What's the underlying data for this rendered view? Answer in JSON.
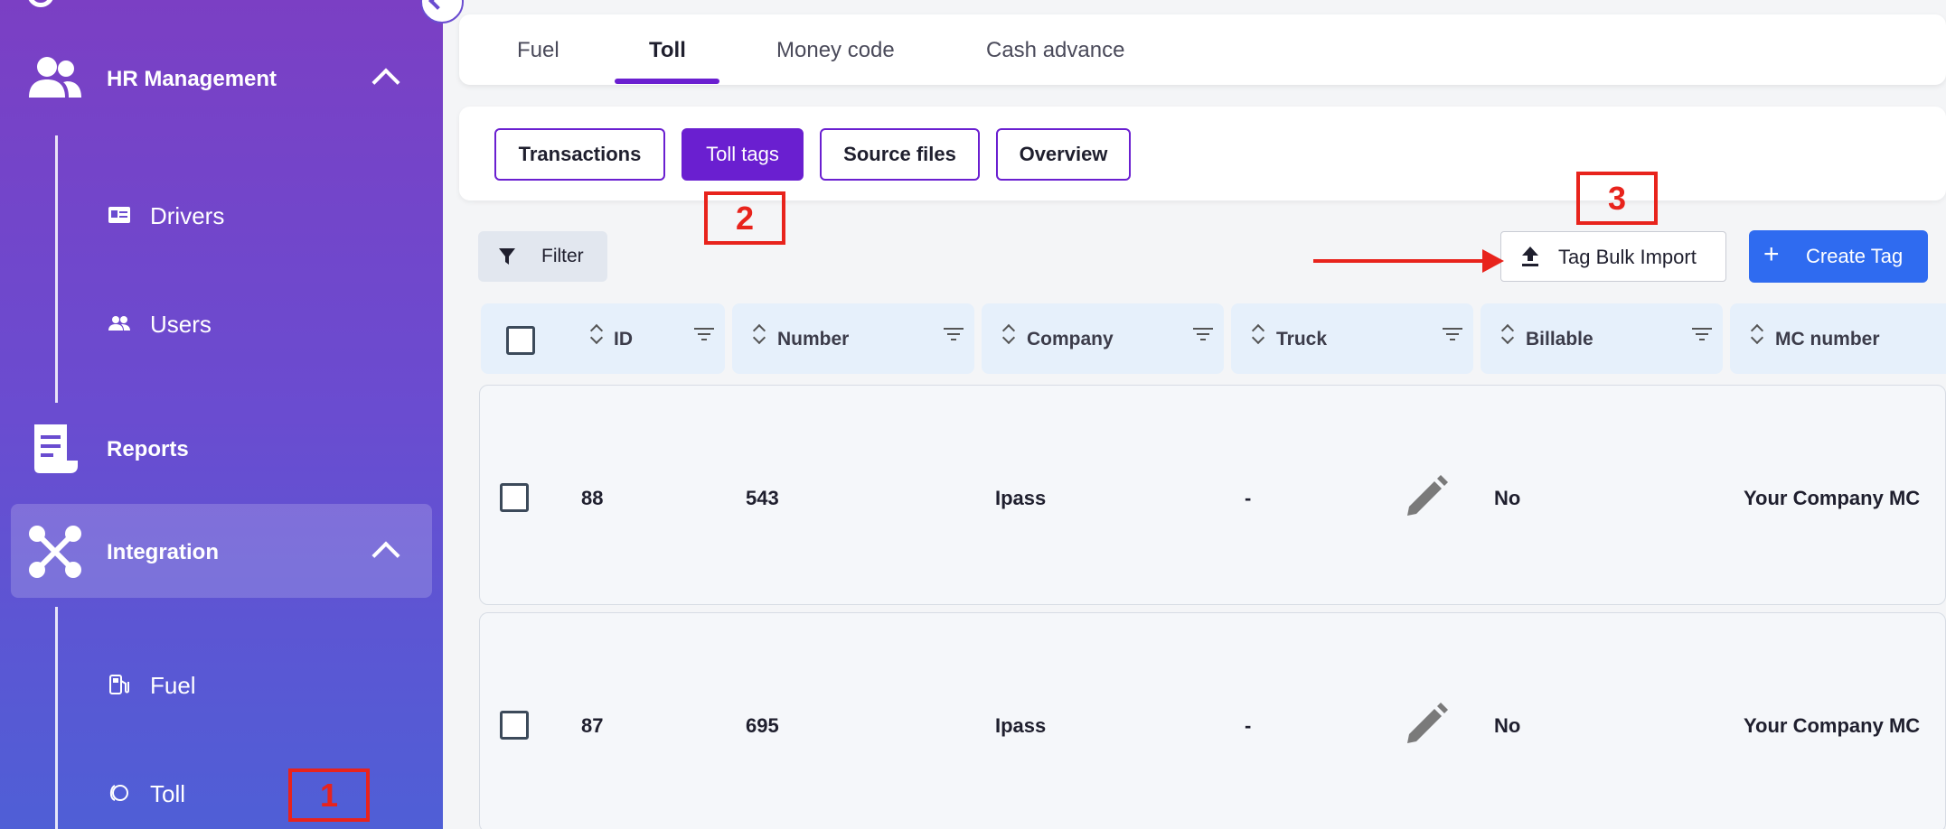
{
  "sidebar": {
    "hr_management": "HR Management",
    "drivers": "Drivers",
    "users": "Users",
    "reports": "Reports",
    "integration": "Integration",
    "fuel": "Fuel",
    "toll": "Toll"
  },
  "top_tabs": [
    "Fuel",
    "Toll",
    "Money code",
    "Cash advance"
  ],
  "active_top_tab": "Toll",
  "sub_tabs": [
    "Transactions",
    "Toll tags",
    "Source files",
    "Overview"
  ],
  "active_sub_tab": "Toll tags",
  "toolbar": {
    "filter_label": "Filter",
    "import_label": "Tag Bulk Import",
    "create_plus": "+",
    "create_label": "Create Tag"
  },
  "annotations": [
    "1",
    "2",
    "3"
  ],
  "table": {
    "columns": [
      "ID",
      "Number",
      "Company",
      "Truck",
      "Billable",
      "MC number"
    ],
    "rows": [
      {
        "id": "88",
        "number": "543",
        "company": "Ipass",
        "truck": "-",
        "billable": "No",
        "mc_number": "Your Company MC"
      },
      {
        "id": "87",
        "number": "695",
        "company": "Ipass",
        "truck": "-",
        "billable": "No",
        "mc_number": "Your Company MC"
      }
    ]
  },
  "colors": {
    "accent_purple": "#6a1fd0",
    "primary_blue": "#2f6bf0",
    "annotation_red": "#e8231c",
    "sidebar_top": "#7b3fc4",
    "sidebar_bottom": "#4f5fd6"
  },
  "icons": {
    "hr_management": "people-icon",
    "drivers": "id-card-icon",
    "users": "users-icon",
    "reports": "document-icon",
    "integration": "integration-icon",
    "fuel": "fuel-pump-icon",
    "toll": "toll-icon",
    "filter": "funnel-icon",
    "import": "upload-icon",
    "edit": "pencil-icon"
  }
}
